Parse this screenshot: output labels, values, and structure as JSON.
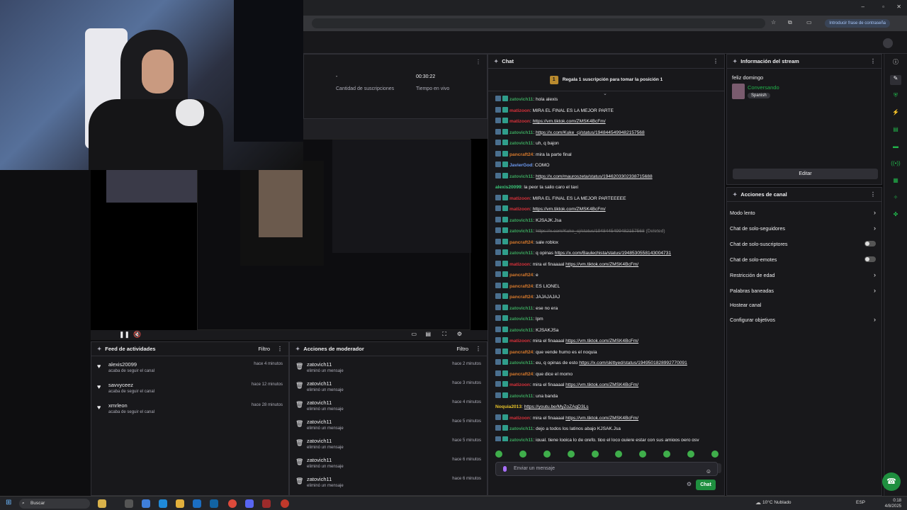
{
  "browser": {
    "password_chip": "Introducir frase de contraseña"
  },
  "stats": {
    "subs_value": "-",
    "subs_label": "Cantidad de suscripciones",
    "live_value": "00:30:22",
    "live_label": "Tiempo en vivo"
  },
  "chat": {
    "title": "Chat",
    "promo": "Regala 1 suscripción para tomar la posición 1",
    "promo_rank": "1",
    "input_placeholder": "Enviar un mensaje",
    "send_label": "Chat",
    "messages": [
      {
        "user": "zatovich11",
        "color": "#3ba55d",
        "badges": true,
        "text": ": hola alexis",
        "link": "",
        "link_style": ""
      },
      {
        "user": "matizoon",
        "color": "#d9313a",
        "badges": true,
        "text": ": MIRA EL FINAL ES LA MEJOR PARTE",
        "link": "",
        "link_style": ""
      },
      {
        "user": "matizoon",
        "color": "#d9313a",
        "badges": true,
        "text": ": ",
        "link": "https://vm.tiktok.com/ZMSK4BcFm/",
        "link_style": "lnk"
      },
      {
        "user": "zatovich11",
        "color": "#3ba55d",
        "badges": true,
        "text": ": ",
        "link": "https://x.com/Kuke_cj/status/1948445499482157568",
        "link_style": "lnk"
      },
      {
        "user": "zatovich11",
        "color": "#3ba55d",
        "badges": true,
        "text": ": uh, q bajon",
        "link": "",
        "link_style": ""
      },
      {
        "user": "pancraft24",
        "color": "#d6792c",
        "badges": true,
        "text": ": mira la parte final",
        "link": "",
        "link_style": ""
      },
      {
        "user": "JavierGod",
        "color": "#6e9cf5",
        "badges": true,
        "text": ": COMO",
        "link": "",
        "link_style": ""
      },
      {
        "user": "zatovich11",
        "color": "#3ba55d",
        "badges": true,
        "text": ": ",
        "link": "https://x.com/mauroszeta/status/1946203302338715688",
        "link_style": "lnk"
      },
      {
        "user": "alexis20099",
        "color": "#3cc97a",
        "badges": false,
        "text": ": la peor ta salio caro el taxi",
        "link": "",
        "link_style": ""
      },
      {
        "user": "matizoon",
        "color": "#d9313a",
        "badges": true,
        "text": ": MIRA EL FINAL ES LA MEJOR PARTEEEEE",
        "link": "",
        "link_style": ""
      },
      {
        "user": "matizoon",
        "color": "#d9313a",
        "badges": true,
        "text": ": ",
        "link": "https://vm.tiktok.com/ZMSK4BcFm/",
        "link_style": "lnk"
      },
      {
        "user": "zatovich11",
        "color": "#3ba55d",
        "badges": true,
        "text": ": KJSAJK.Jsa",
        "link": "",
        "link_style": ""
      },
      {
        "user": "zatovich11",
        "color": "#3ba55d",
        "badges": true,
        "text": ": ",
        "link": "https://x.com/Kuke_cj/status/1948445499482157568",
        "link_style": "del",
        "note": " (Deleted)"
      },
      {
        "user": "pancraft24",
        "color": "#d6792c",
        "badges": true,
        "text": ": sale roblox",
        "link": "",
        "link_style": ""
      },
      {
        "user": "zatovich11",
        "color": "#3ba55d",
        "badges": true,
        "text": ": q opinas ",
        "link": "https://x.com/Baulechista/status/1948530558143004731",
        "link_style": "lnk"
      },
      {
        "user": "matizoon",
        "color": "#d9313a",
        "badges": true,
        "text": ": mira el finaaaal ",
        "link": "https://vm.tiktok.com/ZMSK4BcFm/",
        "link_style": "lnk"
      },
      {
        "user": "pancraft24",
        "color": "#d6792c",
        "badges": true,
        "text": ": e",
        "link": "",
        "link_style": ""
      },
      {
        "user": "pancraft24",
        "color": "#d6792c",
        "badges": true,
        "text": ": ES LIONEL",
        "link": "",
        "link_style": ""
      },
      {
        "user": "pancraft24",
        "color": "#d6792c",
        "badges": true,
        "text": ": JAJAJAJAJ",
        "link": "",
        "link_style": ""
      },
      {
        "user": "zatovich11",
        "color": "#3ba55d",
        "badges": true,
        "text": ": ese no era",
        "link": "",
        "link_style": ""
      },
      {
        "user": "zatovich11",
        "color": "#3ba55d",
        "badges": true,
        "text": ": lpm",
        "link": "",
        "link_style": ""
      },
      {
        "user": "zatovich11",
        "color": "#3ba55d",
        "badges": true,
        "text": ": KJSAKJSa",
        "link": "",
        "link_style": ""
      },
      {
        "user": "matizoon",
        "color": "#d9313a",
        "badges": true,
        "text": ": mira el finaaaal ",
        "link": "https://vm.tiktok.com/ZMSK4BcFm/",
        "link_style": "lnk"
      },
      {
        "user": "pancraft24",
        "color": "#d6792c",
        "badges": true,
        "text": ": que vende humo es el noquia",
        "link": "",
        "link_style": ""
      },
      {
        "user": "zatovich11",
        "color": "#3ba55d",
        "badges": true,
        "text": ": eu, q opinas de esto ",
        "link": "https://x.com/skittyed/status/1949501828992770091",
        "link_style": "lnk"
      },
      {
        "user": "pancraft24",
        "color": "#d6792c",
        "badges": true,
        "text": ": que dice el momo",
        "link": "",
        "link_style": ""
      },
      {
        "user": "matizoon",
        "color": "#d9313a",
        "badges": true,
        "text": ": mira el finaaaal ",
        "link": "https://vm.tiktok.com/ZMSK4BcFm/",
        "link_style": "lnk"
      },
      {
        "user": "zatovich11",
        "color": "#3ba55d",
        "badges": true,
        "text": ": una banda",
        "link": "",
        "link_style": ""
      },
      {
        "user": "Noquia2013",
        "color": "#e6c229",
        "badges": false,
        "text": ": ",
        "link": "https://youtu.be/MyZoZAqD3Ls",
        "link_style": "lnk"
      },
      {
        "user": "matizoon",
        "color": "#d9313a",
        "badges": true,
        "text": ": mira el finaaaal ",
        "link": "https://vm.tiktok.com/ZMSK4BcFm/",
        "link_style": "lnk"
      },
      {
        "user": "zatovich11",
        "color": "#3ba55d",
        "badges": true,
        "text": ": dejo a todos los latinos abajo KJSAK.Jsa",
        "link": "",
        "link_style": ""
      },
      {
        "user": "zatovich11",
        "color": "#3ba55d",
        "badges": true,
        "text": ": igual, tiene logica lo de grefg, tipo el loco quiere estar con sus amigos pero qsy",
        "link": "",
        "link_style": ""
      }
    ]
  },
  "activity": {
    "title": "Feed de actividades",
    "filter": "Filtro",
    "items": [
      {
        "name": "alexis20099",
        "sub": "acaba de seguir el canal",
        "time": "hace 4 minutos"
      },
      {
        "name": "savvyceez",
        "sub": "acaba de seguir el canal",
        "time": "hace 12 minutos"
      },
      {
        "name": "xmrleon",
        "sub": "acaba de seguir el canal",
        "time": "hace 28 minutos"
      }
    ]
  },
  "modactions": {
    "title": "Acciones de moderador",
    "filter": "Filtro",
    "items": [
      {
        "name": "zatovich11",
        "sub": "eliminó un mensaje",
        "time": "hace 2 minutos"
      },
      {
        "name": "zatovich11",
        "sub": "eliminó un mensaje",
        "time": "hace 3 minutos"
      },
      {
        "name": "zatovich11",
        "sub": "eliminó un mensaje",
        "time": "hace 4 minutos"
      },
      {
        "name": "zatovich11",
        "sub": "eliminó un mensaje",
        "time": "hace 5 minutos"
      },
      {
        "name": "zatovich11",
        "sub": "eliminó un mensaje",
        "time": "hace 5 minutos"
      },
      {
        "name": "zatovich11",
        "sub": "eliminó un mensaje",
        "time": "hace 6 minutos"
      },
      {
        "name": "zatovich11",
        "sub": "eliminó un mensaje",
        "time": "hace 6 minutos"
      }
    ]
  },
  "streaminfo": {
    "title": "Información del stream",
    "stream_title": "feliz domingo",
    "category": "Conversando",
    "tag": "Spanish",
    "edit": "Editar"
  },
  "channel": {
    "title": "Acciones de canal",
    "actions": [
      {
        "label": "Modo lento",
        "control": "chevron"
      },
      {
        "label": "Chat de solo-seguidores",
        "control": "chevron"
      },
      {
        "label": "Chat de solo-suscriptores",
        "control": "toggle"
      },
      {
        "label": "Chat de solo-emotes",
        "control": "toggle"
      },
      {
        "label": "Restricción de edad",
        "control": "chevron"
      },
      {
        "label": "Palabras baneadas",
        "control": "chevron"
      },
      {
        "label": "Hostear canal",
        "control": "none"
      },
      {
        "label": "Configurar objetivos",
        "control": "chevron"
      }
    ]
  },
  "taskbar": {
    "search": "Buscar",
    "weather": "10°C  Nublado",
    "lang": "ESP",
    "time": "0:18",
    "date": "4/8/2025"
  },
  "colors": {
    "accent_green": "#1f8f3f",
    "brand_green": "#21b34a",
    "panel_bg": "#18181b"
  }
}
